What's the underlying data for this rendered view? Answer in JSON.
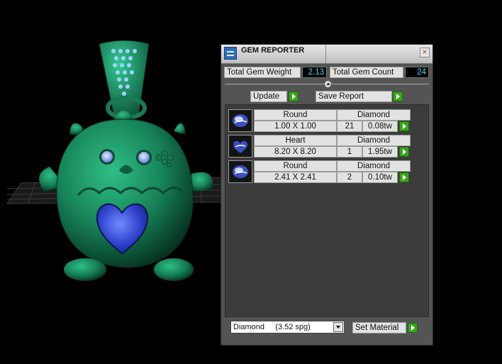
{
  "window": {
    "title": "GEM REPORTER",
    "close_icon": "close-icon"
  },
  "stats": {
    "total_weight_label": "Total Gem Weight",
    "total_weight_value": "2.13",
    "total_count_label": "Total Gem Count",
    "total_count_value": "24"
  },
  "toolbar": {
    "update_label": "Update",
    "save_report_label": "Save Report"
  },
  "gems": [
    {
      "shape": "Round",
      "size": "1.00 X 1.00",
      "material": "Diamond",
      "count": "21",
      "weight": "0.08tw"
    },
    {
      "shape": "Heart",
      "size": "8.20 X 8.20",
      "material": "Diamond",
      "count": "1",
      "weight": "1.95tw"
    },
    {
      "shape": "Round",
      "size": "2.41 X 2.41",
      "material": "Diamond",
      "count": "2",
      "weight": "0.10tw"
    }
  ],
  "footer": {
    "material_select": "Diamond     (3.52 spg)",
    "set_material_label": "Set Material"
  },
  "colors": {
    "model": "#1f8f62",
    "gem_blue": "#3a5bd8",
    "accent_green": "#3aa41b",
    "value_cyan": "#4fd3ff"
  }
}
